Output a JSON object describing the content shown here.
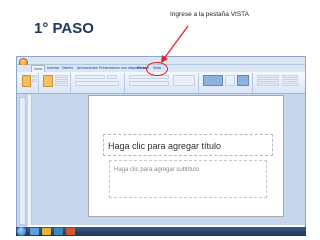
{
  "heading": "1° PASO",
  "instruction": "Ingrese a la pestaña VISTA",
  "ppt": {
    "tabs": [
      "Inicio",
      "Insertar",
      "Diseño",
      "Animaciones",
      "Presentación con diapositivas",
      "Revisar",
      "Vista"
    ],
    "active_tab_index": 0,
    "highlighted_tab": "Vista",
    "slide": {
      "title_placeholder": "Haga clic para agregar título",
      "subtitle_placeholder": "Haga clic para agregar subtítulo"
    }
  },
  "colors": {
    "annotation": "#e02424",
    "heading": "#1f3a60"
  }
}
